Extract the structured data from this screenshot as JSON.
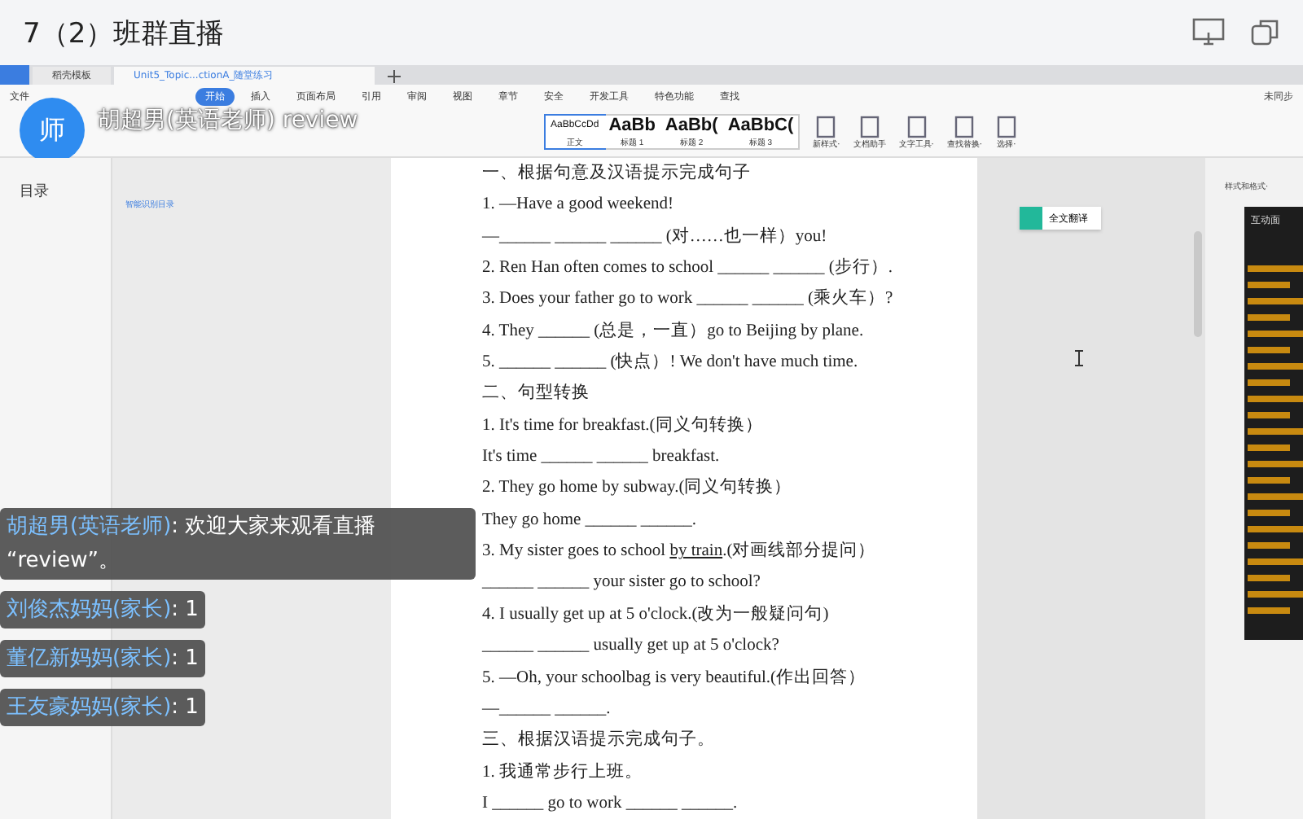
{
  "header": {
    "title": "7（2）班群直播"
  },
  "app": {
    "tabs": [
      {
        "label": "稻壳模板",
        "selected": false
      },
      {
        "label": "Unit5_Topic...ctionA_随堂练习",
        "selected": true
      }
    ],
    "menu": [
      {
        "label": "文件",
        "selected": false
      },
      {
        "label": "开始",
        "selected": true
      },
      {
        "label": "插入",
        "selected": false
      },
      {
        "label": "页面布局",
        "selected": false
      },
      {
        "label": "引用",
        "selected": false
      },
      {
        "label": "审阅",
        "selected": false
      },
      {
        "label": "视图",
        "selected": false
      },
      {
        "label": "章节",
        "selected": false
      },
      {
        "label": "安全",
        "selected": false
      },
      {
        "label": "开发工具",
        "selected": false
      },
      {
        "label": "特色功能",
        "selected": false
      },
      {
        "label": "查找",
        "selected": false
      }
    ],
    "sync": "未同步",
    "styles": [
      {
        "sample": "AaBbCcDd",
        "name": "正文",
        "selected": true
      },
      {
        "sample": "AaBb",
        "name": "标题 1",
        "selected": false
      },
      {
        "sample": "AaBb(",
        "name": "标题 2",
        "selected": false
      },
      {
        "sample": "AaBbC(",
        "name": "标题 3",
        "selected": false
      }
    ],
    "tools": [
      "新样式·",
      "文档助手",
      "文字工具·",
      "查找替换·",
      "选择·"
    ]
  },
  "presenter": {
    "avatar": "师",
    "name": "胡超男(英语老师) review"
  },
  "outline": {
    "title": "目录",
    "action": "智能识别目录"
  },
  "document": {
    "lines": [
      {
        "text": "一、根据句意及汉语提示完成句子"
      },
      {
        "text": "1. —Have a good weekend!"
      },
      {
        "text": "—______ ______ ______ (对……也一样）you!"
      },
      {
        "text": "2. Ren Han often comes to school ______ ______ (步行）."
      },
      {
        "text": "3. Does your father go to work ______ ______ (乘火车）?"
      },
      {
        "text": "4. They ______ (总是，一直）go to Beijing by plane."
      },
      {
        "text": "5. ______ ______ (快点）! We don't have much time."
      },
      {
        "text": "二、句型转换"
      },
      {
        "text": "1. It's time for breakfast.(同义句转换）"
      },
      {
        "text": "It's time ______ ______ breakfast."
      },
      {
        "text": "2. They go home by subway.(同义句转换）"
      },
      {
        "text": "They go home ______ ______."
      },
      {
        "text": "3. My sister goes to school ",
        "underlined": "by train",
        "after": ".(对画线部分提问）"
      },
      {
        "text": "______ ______ your sister go to school?"
      },
      {
        "text": "4. I usually get up at 5 o'clock.(改为一般疑问句)"
      },
      {
        "text": "______ ______ usually get up at 5 o'clock?"
      },
      {
        "text": "5. —Oh, your schoolbag is very beautiful.(作出回答）"
      },
      {
        "text": "—______ ______."
      },
      {
        "text": "三、根据汉语提示完成句子。"
      },
      {
        "text": "1. 我通常步行上班。"
      },
      {
        "text": "I ______ go to work ______ ______."
      }
    ]
  },
  "translate_button": "全文翻译",
  "side_panel": {
    "title": "样式和格式·",
    "interaction_title": "互动面"
  },
  "chat": [
    {
      "sender": "胡超男(英语老师)",
      "message": ": 欢迎大家来观看直播 “review”。"
    },
    {
      "sender": "刘俊杰妈妈(家长)",
      "message": ": 1"
    },
    {
      "sender": "董亿新妈妈(家长)",
      "message": ": 1"
    },
    {
      "sender": "王友豪妈妈(家长)",
      "message": ": 1"
    }
  ]
}
